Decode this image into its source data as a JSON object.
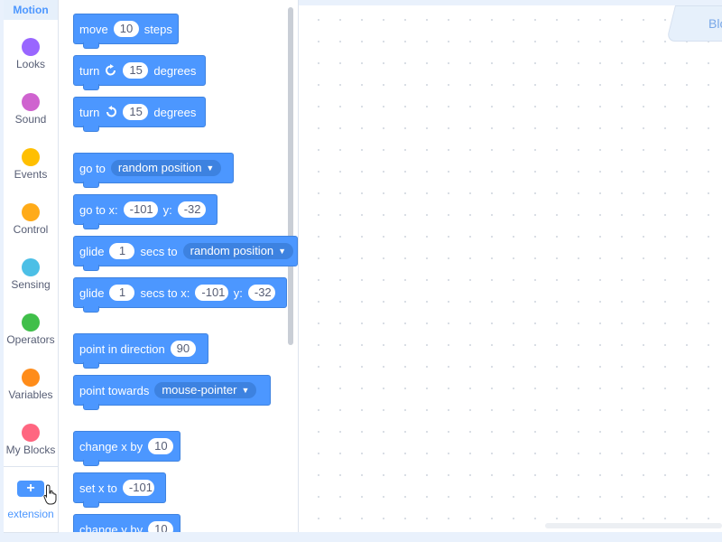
{
  "categories": [
    {
      "label": "Motion",
      "color": "#4c97ff",
      "active": true
    },
    {
      "label": "Looks",
      "color": "#9966ff"
    },
    {
      "label": "Sound",
      "color": "#cf63cf"
    },
    {
      "label": "Events",
      "color": "#ffbf00"
    },
    {
      "label": "Control",
      "color": "#ffab19"
    },
    {
      "label": "Sensing",
      "color": "#4cbfe6"
    },
    {
      "label": "Operators",
      "color": "#40bf4a"
    },
    {
      "label": "Variables",
      "color": "#ff8c1a"
    },
    {
      "label": "My Blocks",
      "color": "#ff6680"
    }
  ],
  "extension": {
    "icon": "+",
    "label": "extension"
  },
  "blocks": {
    "move": {
      "t1": "move",
      "v1": "10",
      "t2": "steps"
    },
    "turn_right": {
      "t1": "turn",
      "v1": "15",
      "t2": "degrees",
      "icon": "rotate-right-icon"
    },
    "turn_left": {
      "t1": "turn",
      "v1": "15",
      "t2": "degrees",
      "icon": "rotate-left-icon"
    },
    "goto": {
      "t1": "go to",
      "d1": "random position"
    },
    "goto_xy": {
      "t1": "go to x:",
      "v1": "-101",
      "t2": "y:",
      "v2": "-32"
    },
    "glide_to": {
      "t1": "glide",
      "v1": "1",
      "t2": "secs to",
      "d1": "random position"
    },
    "glide_xy": {
      "t1": "glide",
      "v1": "1",
      "t2": "secs to x:",
      "v2": "-101",
      "t3": "y:",
      "v3": "-32"
    },
    "point_dir": {
      "t1": "point in direction",
      "v1": "90"
    },
    "point_towards": {
      "t1": "point towards",
      "d1": "mouse-pointer"
    },
    "change_x": {
      "t1": "change x by",
      "v1": "10"
    },
    "set_x": {
      "t1": "set x to",
      "v1": "-101"
    },
    "change_y": {
      "t1": "change y by",
      "v1": "10"
    }
  },
  "workspace": {
    "tab_label": "Blo"
  }
}
